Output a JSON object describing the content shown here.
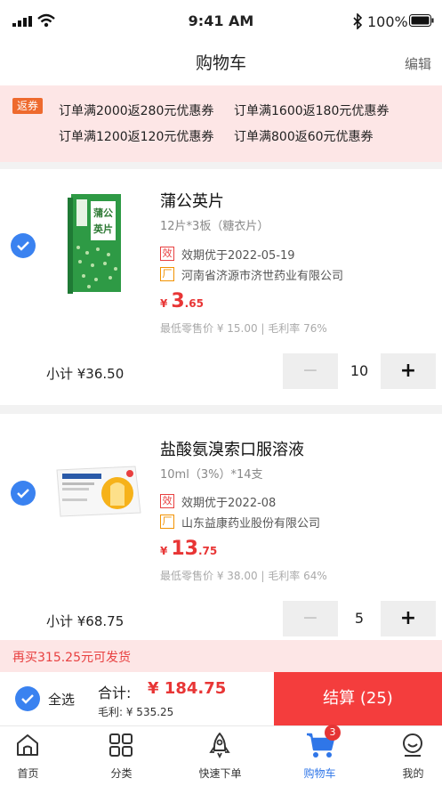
{
  "status_bar": {
    "time": "9:41 AM",
    "battery": "100%"
  },
  "nav": {
    "title": "购物车",
    "edit": "编辑"
  },
  "promo": {
    "tag": "返券",
    "coupons": [
      "订单满2000返280元优惠券",
      "订单满1600返180元优惠券",
      "订单满1200返120元优惠券",
      "订单满800返60元优惠券"
    ]
  },
  "items": [
    {
      "name": "蒲公英片",
      "spec": "12片*3板（糖衣片）",
      "expiry_badge": "效",
      "expiry": "效期优于2022-05-19",
      "maker_badge": "厂",
      "maker": "河南省济源市济世药业有限公司",
      "price_symbol": "¥",
      "price_int": "3",
      "price_dec": ".65",
      "retail": "最低零售价 ¥ 15.00 | 毛利率 76%",
      "subtotal": "小计 ¥36.50",
      "minus": "−",
      "plus": "+",
      "qty": "10"
    },
    {
      "name": "盐酸氨溴索口服溶液",
      "spec": "10ml（3%）*14支",
      "expiry_badge": "效",
      "expiry": "效期优于2022-08",
      "maker_badge": "厂",
      "maker": "山东益康药业股份有限公司",
      "price_symbol": "¥",
      "price_int": "13",
      "price_dec": ".75",
      "retail": "最低零售价 ¥ 38.00 | 毛利率 64%",
      "subtotal": "小计 ¥68.75",
      "minus": "−",
      "plus": "+",
      "qty": "5"
    }
  ],
  "shipping_notice": "再买315.25元可发货",
  "checkout": {
    "select_all": "全选",
    "total_label": "合计:",
    "total": "¥ 184.75",
    "profit": "毛利: ¥ 535.25",
    "button": "结算 (25)"
  },
  "tabs": [
    {
      "label": "首页",
      "icon": "home-icon"
    },
    {
      "label": "分类",
      "icon": "category-icon"
    },
    {
      "label": "快速下单",
      "icon": "rocket-icon"
    },
    {
      "label": "购物车",
      "icon": "cart-icon",
      "badge": "3",
      "active": true
    },
    {
      "label": "我的",
      "icon": "profile-icon"
    }
  ],
  "colors": {
    "accent": "#3a82f0",
    "price": "#e83535",
    "checkout": "#f43d3d",
    "promo_bg": "#fde6e6"
  }
}
